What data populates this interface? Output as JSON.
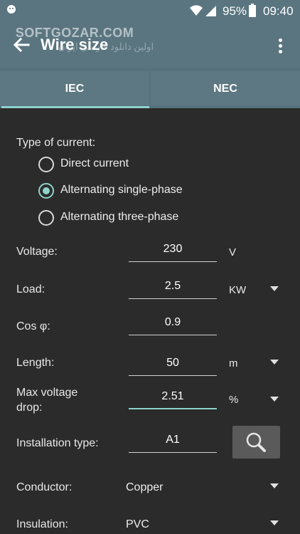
{
  "status_bar": {
    "battery": "95%",
    "time": "09:40"
  },
  "watermark": {
    "text": "SOFTGOZAR.COM",
    "subtext": "اولین دانلود فارسی ایران"
  },
  "app_bar": {
    "title": "Wire size"
  },
  "tabs": [
    {
      "label": "IEC",
      "selected": true
    },
    {
      "label": "NEC",
      "selected": false
    }
  ],
  "current_type": {
    "label": "Type of current:",
    "options": [
      {
        "label": "Direct current",
        "checked": false
      },
      {
        "label": "Alternating single-phase",
        "checked": true
      },
      {
        "label": "Alternating three-phase",
        "checked": false
      }
    ]
  },
  "fields": {
    "voltage": {
      "label": "Voltage:",
      "value": "230",
      "unit": "V"
    },
    "load": {
      "label": "Load:",
      "value": "2.5",
      "unit": "KW"
    },
    "cos_phi": {
      "label": "Cos φ:",
      "value": "0.9"
    },
    "length": {
      "label": "Length:",
      "value": "50",
      "unit": "m"
    },
    "max_voltage_drop": {
      "label_line1": "Max voltage",
      "label_line2": "drop:",
      "value": "2.51",
      "unit": "%"
    },
    "installation_type": {
      "label": "Installation type:",
      "value": "A1"
    },
    "conductor": {
      "label": "Conductor:",
      "value": "Copper"
    },
    "insulation": {
      "label": "Insulation:",
      "value": "PVC"
    }
  },
  "colors": {
    "app_bar": "#5a7580",
    "accent": "#8fd3cc",
    "background": "#2b2b2b"
  }
}
